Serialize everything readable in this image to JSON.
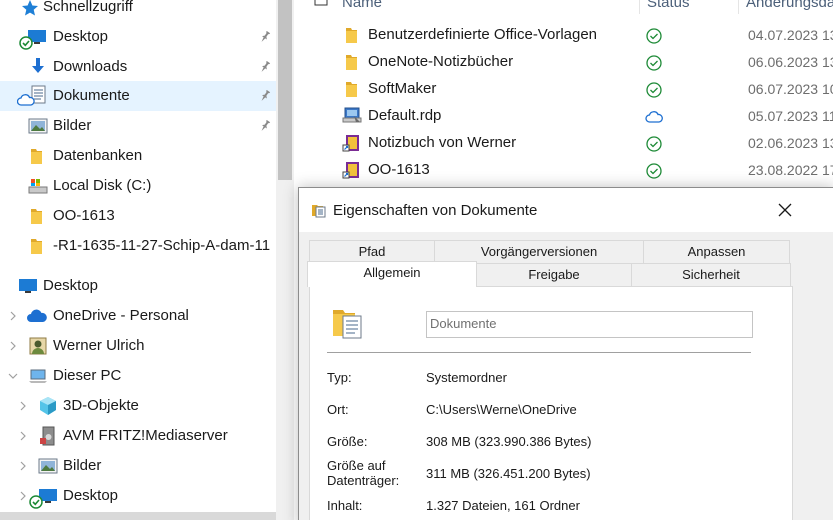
{
  "sidebar": {
    "quick_access_label": "Schnellzugriff",
    "items": [
      {
        "label": "Desktop",
        "icon": "desktop-icon"
      },
      {
        "label": "Downloads",
        "icon": "download-arrow-icon"
      },
      {
        "label": "Dokumente",
        "icon": "documents-icon"
      },
      {
        "label": "Bilder",
        "icon": "pictures-icon"
      },
      {
        "label": "Datenbanken",
        "icon": "folder-icon"
      },
      {
        "label": "Local Disk (C:)",
        "icon": "drive-icon"
      },
      {
        "label": "OO-1613",
        "icon": "folder-icon"
      },
      {
        "label": "-R1-1635-11-27-Schip-A-dam-11",
        "icon": "folder-icon"
      },
      {
        "label": "Desktop",
        "icon": "desktop-icon"
      },
      {
        "label": "OneDrive - Personal",
        "icon": "cloud-icon"
      },
      {
        "label": "Werner Ulrich",
        "icon": "user-icon"
      },
      {
        "label": "Dieser PC",
        "icon": "computer-icon"
      },
      {
        "label": "3D-Objekte",
        "icon": "cube-icon"
      },
      {
        "label": "AVM FRITZ!Mediaserver",
        "icon": "media-server-icon"
      },
      {
        "label": "Bilder",
        "icon": "pictures-icon"
      },
      {
        "label": "Desktop",
        "icon": "desktop-icon"
      }
    ],
    "colors": {
      "selected_bg": "#e5f3ff",
      "accent": "#0078d7"
    }
  },
  "filelist": {
    "columns": {
      "name": "Name",
      "status": "Status",
      "date": "Änderungsdatum"
    },
    "rows": [
      {
        "name": "Benutzerdefinierte Office-Vorlagen",
        "status": "synced",
        "date": "04.07.2023 13",
        "icon": "folder-icon"
      },
      {
        "name": "OneNote-Notizbücher",
        "status": "synced",
        "date": "06.06.2023 13",
        "icon": "folder-icon"
      },
      {
        "name": "SoftMaker",
        "status": "synced",
        "date": "06.07.2023 10",
        "icon": "folder-icon"
      },
      {
        "name": "Default.rdp",
        "status": "cloud",
        "date": "05.07.2023 11",
        "icon": "remote-desktop-icon"
      },
      {
        "name": "Notizbuch von Werner",
        "status": "synced",
        "date": "02.06.2023 13",
        "icon": "onenote-link-icon"
      },
      {
        "name": "OO-1613",
        "status": "synced",
        "date": "23.08.2022 17",
        "icon": "onenote-link-icon"
      }
    ]
  },
  "dialog": {
    "title": "Eigenschaften von Dokumente",
    "tabs_row1": [
      "Pfad",
      "Vorgängerversionen",
      "Anpassen"
    ],
    "tabs_row2": [
      "Allgemein",
      "Freigabe",
      "Sicherheit"
    ],
    "name_value": "Dokumente",
    "props": [
      {
        "label": "Typ:",
        "value": "Systemordner"
      },
      {
        "label": "Ort:",
        "value": "C:\\Users\\Werne\\OneDrive"
      },
      {
        "label": "Größe:",
        "value": "308 MB (323.990.386 Bytes)"
      },
      {
        "label": "Größe auf Datenträger:",
        "value": "311 MB (326.451.200 Bytes)"
      },
      {
        "label": "Inhalt:",
        "value": "1.327 Dateien, 161 Ordner"
      }
    ]
  }
}
